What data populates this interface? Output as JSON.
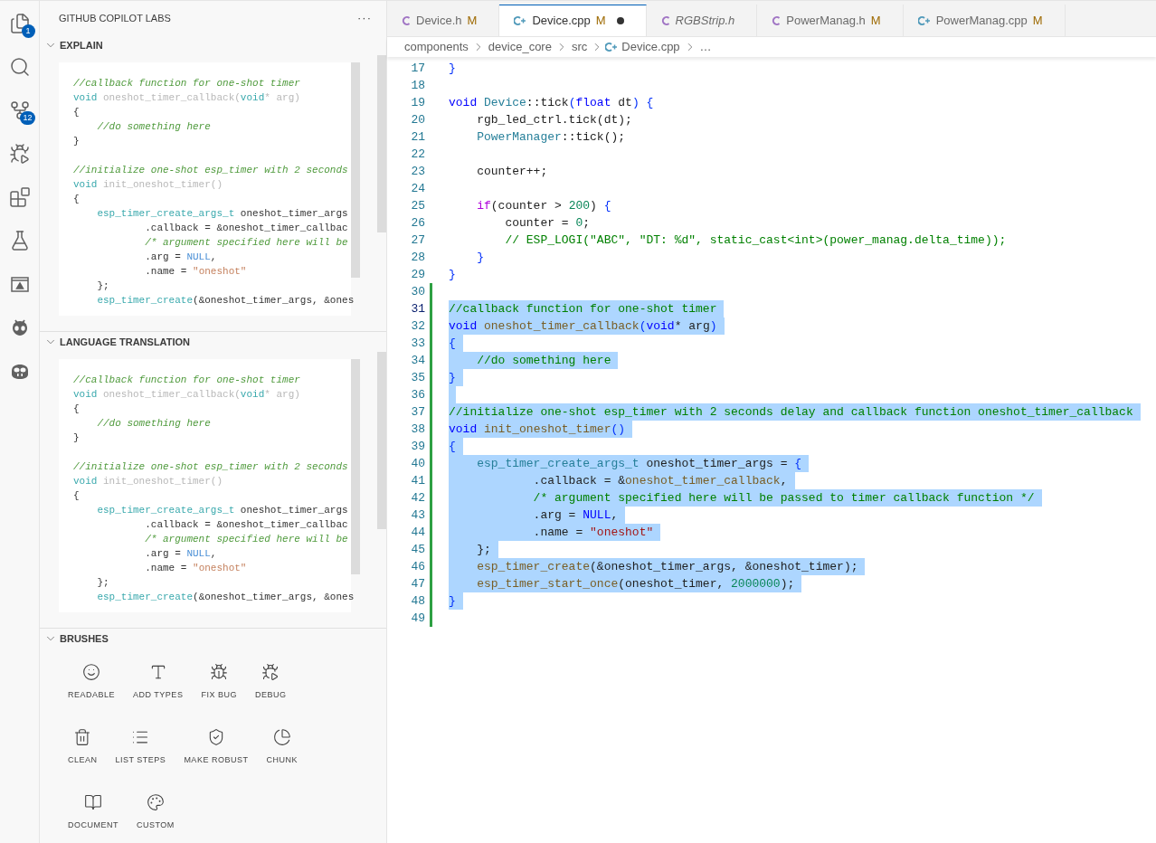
{
  "activity_bar": [
    {
      "kind": "files",
      "badge": "1"
    },
    {
      "kind": "search"
    },
    {
      "kind": "source-control",
      "badge": "12"
    },
    {
      "kind": "run-debug"
    },
    {
      "kind": "extensions"
    },
    {
      "kind": "flask"
    },
    {
      "kind": "window"
    },
    {
      "kind": "alien"
    },
    {
      "kind": "copilot"
    }
  ],
  "sidebar": {
    "title": "GITHUB COPILOT LABS",
    "menu": "···",
    "sections": [
      {
        "title": "EXPLAIN",
        "expanded": true,
        "kind": "preview",
        "blocks": [
          [
            [
              {
                "kind": "com",
                "text": "//callback function for one-shot timer"
              }
            ],
            [
              {
                "kind": "kw",
                "text": "void"
              },
              {
                "kind": "dim",
                "text": " oneshot_timer_callback("
              },
              {
                "kind": "kw",
                "text": "void"
              },
              {
                "kind": "dim",
                "text": "* arg)"
              }
            ],
            [
              {
                "kind": "plain",
                "text": "{"
              }
            ],
            [
              {
                "kind": "com",
                "text": "    //do something here"
              }
            ],
            [
              {
                "kind": "plain",
                "text": "}"
              }
            ]
          ],
          [
            [
              {
                "kind": "com",
                "text": "//initialize one-shot esp_timer with 2 seconds"
              }
            ],
            [
              {
                "kind": "kw",
                "text": "void"
              },
              {
                "kind": "dim",
                "text": " init_oneshot_timer()"
              }
            ],
            [
              {
                "kind": "plain",
                "text": "{"
              }
            ],
            [
              {
                "kind": "type",
                "text": "    esp_timer_create_args_t"
              },
              {
                "kind": "plain",
                "text": " oneshot_timer_args"
              }
            ],
            [
              {
                "kind": "plain",
                "text": "            .callback = &oneshot_timer_callbac"
              }
            ],
            [
              {
                "kind": "com",
                "text": "            /* argument specified here will be"
              }
            ],
            [
              {
                "kind": "plain",
                "text": "            .arg = "
              },
              {
                "kind": "const",
                "text": "NULL"
              },
              {
                "kind": "plain",
                "text": ","
              }
            ],
            [
              {
                "kind": "plain",
                "text": "            .name = "
              },
              {
                "kind": "str",
                "text": "\"oneshot\""
              }
            ],
            [
              {
                "kind": "plain",
                "text": "    };"
              }
            ],
            [
              {
                "kind": "type",
                "text": "    esp_timer_create"
              },
              {
                "kind": "plain",
                "text": "(&oneshot_timer_args, &ones"
              }
            ]
          ]
        ]
      },
      {
        "title": "LANGUAGE TRANSLATION",
        "expanded": true,
        "kind": "preview",
        "blocks": [
          [
            [
              {
                "kind": "com",
                "text": "//callback function for one-shot timer"
              }
            ],
            [
              {
                "kind": "kw",
                "text": "void"
              },
              {
                "kind": "dim",
                "text": " oneshot_timer_callback("
              },
              {
                "kind": "kw",
                "text": "void"
              },
              {
                "kind": "dim",
                "text": "* arg)"
              }
            ],
            [
              {
                "kind": "plain",
                "text": "{"
              }
            ],
            [
              {
                "kind": "com",
                "text": "    //do something here"
              }
            ],
            [
              {
                "kind": "plain",
                "text": "}"
              }
            ]
          ],
          [
            [
              {
                "kind": "com",
                "text": "//initialize one-shot esp_timer with 2 seconds"
              }
            ],
            [
              {
                "kind": "kw",
                "text": "void"
              },
              {
                "kind": "dim",
                "text": " init_oneshot_timer()"
              }
            ],
            [
              {
                "kind": "plain",
                "text": "{"
              }
            ],
            [
              {
                "kind": "type",
                "text": "    esp_timer_create_args_t"
              },
              {
                "kind": "plain",
                "text": " oneshot_timer_args"
              }
            ],
            [
              {
                "kind": "plain",
                "text": "            .callback = &oneshot_timer_callbac"
              }
            ],
            [
              {
                "kind": "com",
                "text": "            /* argument specified here will be"
              }
            ],
            [
              {
                "kind": "plain",
                "text": "            .arg = "
              },
              {
                "kind": "const",
                "text": "NULL"
              },
              {
                "kind": "plain",
                "text": ","
              }
            ],
            [
              {
                "kind": "plain",
                "text": "            .name = "
              },
              {
                "kind": "str",
                "text": "\"oneshot\""
              }
            ],
            [
              {
                "kind": "plain",
                "text": "    };"
              }
            ],
            [
              {
                "kind": "type",
                "text": "    esp_timer_create"
              },
              {
                "kind": "plain",
                "text": "(&oneshot_timer_args, &ones"
              }
            ]
          ]
        ]
      },
      {
        "title": "BRUSHES",
        "expanded": true,
        "kind": "brushes",
        "items": [
          {
            "label": "READABLE",
            "kind": "smile"
          },
          {
            "label": "ADD TYPES",
            "kind": "type"
          },
          {
            "label": "FIX BUG",
            "kind": "bug"
          },
          {
            "label": "DEBUG",
            "kind": "bug-play"
          },
          {
            "label": "CLEAN",
            "kind": "trash"
          },
          {
            "label": "LIST STEPS",
            "kind": "list"
          },
          {
            "label": "MAKE ROBUST",
            "kind": "shield"
          },
          {
            "label": "CHUNK",
            "kind": "pie"
          },
          {
            "label": "DOCUMENT",
            "kind": "book"
          },
          {
            "label": "CUSTOM",
            "kind": "palette"
          }
        ]
      }
    ]
  },
  "tabs": [
    {
      "label": "Device.h",
      "kind": "h",
      "badge": "M",
      "dirty": false,
      "preview": false,
      "selected": false
    },
    {
      "label": "Device.cpp",
      "kind": "cpp",
      "badge": "M",
      "dirty": true,
      "preview": false,
      "selected": true
    },
    {
      "label": "RGBStrip.h",
      "kind": "h",
      "dirty": false,
      "preview": true,
      "selected": false
    },
    {
      "label": "PowerManag.h",
      "kind": "h",
      "badge": "M",
      "dirty": false,
      "preview": false,
      "selected": false
    },
    {
      "label": "PowerManag.cpp",
      "kind": "cpp",
      "badge": "M",
      "dirty": false,
      "preview": false,
      "selected": false
    }
  ],
  "breadcrumb": [
    {
      "label": "components"
    },
    {
      "label": "device_core"
    },
    {
      "label": "src"
    },
    {
      "label": "Device.cpp",
      "kind": "file"
    },
    {
      "label": "…"
    }
  ],
  "editor": {
    "lines": [
      {
        "n": "17",
        "selected": false,
        "added": false,
        "tokens": [
          {
            "kind": "brace",
            "text": "}"
          }
        ]
      },
      {
        "n": "18",
        "selected": false,
        "added": false
      },
      {
        "n": "19",
        "selected": false,
        "added": false,
        "tokens": [
          {
            "kind": "kw",
            "text": "void"
          },
          {
            "kind": "type",
            "text": " Device"
          },
          {
            "kind": "plain",
            "text": "::tick"
          },
          {
            "kind": "brace",
            "text": "("
          },
          {
            "kind": "kw",
            "text": "float"
          },
          {
            "kind": "plain",
            "text": " dt"
          },
          {
            "kind": "brace",
            "text": ")"
          },
          {
            "kind": "brace",
            "text": " {"
          }
        ]
      },
      {
        "n": "20",
        "selected": false,
        "added": false,
        "tokens": [
          {
            "kind": "plain",
            "text": "    rgb_led_ctrl.tick(dt);"
          }
        ]
      },
      {
        "n": "21",
        "selected": false,
        "added": false,
        "tokens": [
          {
            "kind": "type",
            "text": "    PowerManager"
          },
          {
            "kind": "plain",
            "text": "::tick();"
          }
        ]
      },
      {
        "n": "22",
        "selected": false,
        "added": false
      },
      {
        "n": "23",
        "selected": false,
        "added": false,
        "tokens": [
          {
            "kind": "plain",
            "text": "    counter++;"
          }
        ]
      },
      {
        "n": "24",
        "selected": false,
        "added": false
      },
      {
        "n": "25",
        "selected": false,
        "added": false,
        "tokens": [
          {
            "kind": "ctrl",
            "text": "    if"
          },
          {
            "kind": "plain",
            "text": "(counter > "
          },
          {
            "kind": "num",
            "text": "200"
          },
          {
            "kind": "plain",
            "text": ") "
          },
          {
            "kind": "brace",
            "text": "{"
          }
        ]
      },
      {
        "n": "26",
        "selected": false,
        "added": false,
        "tokens": [
          {
            "kind": "plain",
            "text": "        counter = "
          },
          {
            "kind": "num",
            "text": "0"
          },
          {
            "kind": "plain",
            "text": ";"
          }
        ]
      },
      {
        "n": "27",
        "selected": false,
        "added": false,
        "tokens": [
          {
            "kind": "com",
            "text": "        // ESP_LOGI(\"ABC\", \"DT: %d\", static_cast<int>(power_manag.delta_time));"
          }
        ]
      },
      {
        "n": "28",
        "selected": false,
        "added": false,
        "tokens": [
          {
            "kind": "brace",
            "text": "    }"
          }
        ]
      },
      {
        "n": "29",
        "selected": false,
        "added": false,
        "tokens": [
          {
            "kind": "brace",
            "text": "}"
          }
        ]
      },
      {
        "n": "30",
        "selected": false,
        "added": true
      },
      {
        "n": "31",
        "selected": true,
        "added": true,
        "tokens": [
          {
            "kind": "com",
            "text": "//callback function for one-shot timer"
          }
        ]
      },
      {
        "n": "32",
        "selected": true,
        "added": true,
        "tokens": [
          {
            "kind": "kw",
            "text": "void"
          },
          {
            "kind": "fn",
            "text": " oneshot_timer_callback"
          },
          {
            "kind": "brace",
            "text": "("
          },
          {
            "kind": "kw",
            "text": "void"
          },
          {
            "kind": "plain",
            "text": "* arg"
          },
          {
            "kind": "brace",
            "text": ")"
          }
        ]
      },
      {
        "n": "33",
        "selected": true,
        "added": true,
        "tokens": [
          {
            "kind": "brace",
            "text": "{"
          }
        ]
      },
      {
        "n": "34",
        "selected": true,
        "added": true,
        "tokens": [
          {
            "kind": "com",
            "text": "    //do something here"
          }
        ]
      },
      {
        "n": "35",
        "selected": true,
        "added": true,
        "tokens": [
          {
            "kind": "brace",
            "text": "}"
          }
        ]
      },
      {
        "n": "36",
        "selected": true,
        "added": true
      },
      {
        "n": "37",
        "selected": true,
        "added": true,
        "tokens": [
          {
            "kind": "com",
            "text": "//initialize one-shot esp_timer with 2 seconds delay and callback function oneshot_timer_callback"
          }
        ]
      },
      {
        "n": "38",
        "selected": true,
        "added": true,
        "tokens": [
          {
            "kind": "kw",
            "text": "void"
          },
          {
            "kind": "fn",
            "text": " init_oneshot_timer"
          },
          {
            "kind": "brace",
            "text": "()"
          }
        ]
      },
      {
        "n": "39",
        "selected": true,
        "added": true,
        "tokens": [
          {
            "kind": "brace",
            "text": "{"
          }
        ]
      },
      {
        "n": "40",
        "selected": true,
        "added": true,
        "tokens": [
          {
            "kind": "type",
            "text": "    esp_timer_create_args_t"
          },
          {
            "kind": "plain",
            "text": " oneshot_timer_args = "
          },
          {
            "kind": "brace",
            "text": "{"
          }
        ]
      },
      {
        "n": "41",
        "selected": true,
        "added": true,
        "tokens": [
          {
            "kind": "plain",
            "text": "            .callback = &"
          },
          {
            "kind": "fn",
            "text": "oneshot_timer_callback"
          },
          {
            "kind": "plain",
            "text": ","
          }
        ]
      },
      {
        "n": "42",
        "selected": true,
        "added": true,
        "tokens": [
          {
            "kind": "com",
            "text": "            /* argument specified here will be passed to timer callback function */"
          }
        ]
      },
      {
        "n": "43",
        "selected": true,
        "added": true,
        "tokens": [
          {
            "kind": "plain",
            "text": "            .arg = "
          },
          {
            "kind": "const",
            "text": "NULL"
          },
          {
            "kind": "plain",
            "text": ","
          }
        ]
      },
      {
        "n": "44",
        "selected": true,
        "added": true,
        "tokens": [
          {
            "kind": "plain",
            "text": "            .name = "
          },
          {
            "kind": "str",
            "text": "\"oneshot\""
          }
        ]
      },
      {
        "n": "45",
        "selected": true,
        "added": true,
        "tokens": [
          {
            "kind": "plain",
            "text": "    };"
          }
        ]
      },
      {
        "n": "46",
        "selected": true,
        "added": true,
        "tokens": [
          {
            "kind": "fn",
            "text": "    esp_timer_create"
          },
          {
            "kind": "plain",
            "text": "(&oneshot_timer_args, &oneshot_timer);"
          }
        ]
      },
      {
        "n": "47",
        "selected": true,
        "added": true,
        "tokens": [
          {
            "kind": "fn",
            "text": "    esp_timer_start_once"
          },
          {
            "kind": "plain",
            "text": "(oneshot_timer, "
          },
          {
            "kind": "num",
            "text": "2000000"
          },
          {
            "kind": "plain",
            "text": ");"
          }
        ]
      },
      {
        "n": "48",
        "selected": true,
        "added": true,
        "tokens": [
          {
            "kind": "brace",
            "text": "}"
          }
        ]
      },
      {
        "n": "49",
        "selected": false,
        "added": true
      }
    ]
  }
}
